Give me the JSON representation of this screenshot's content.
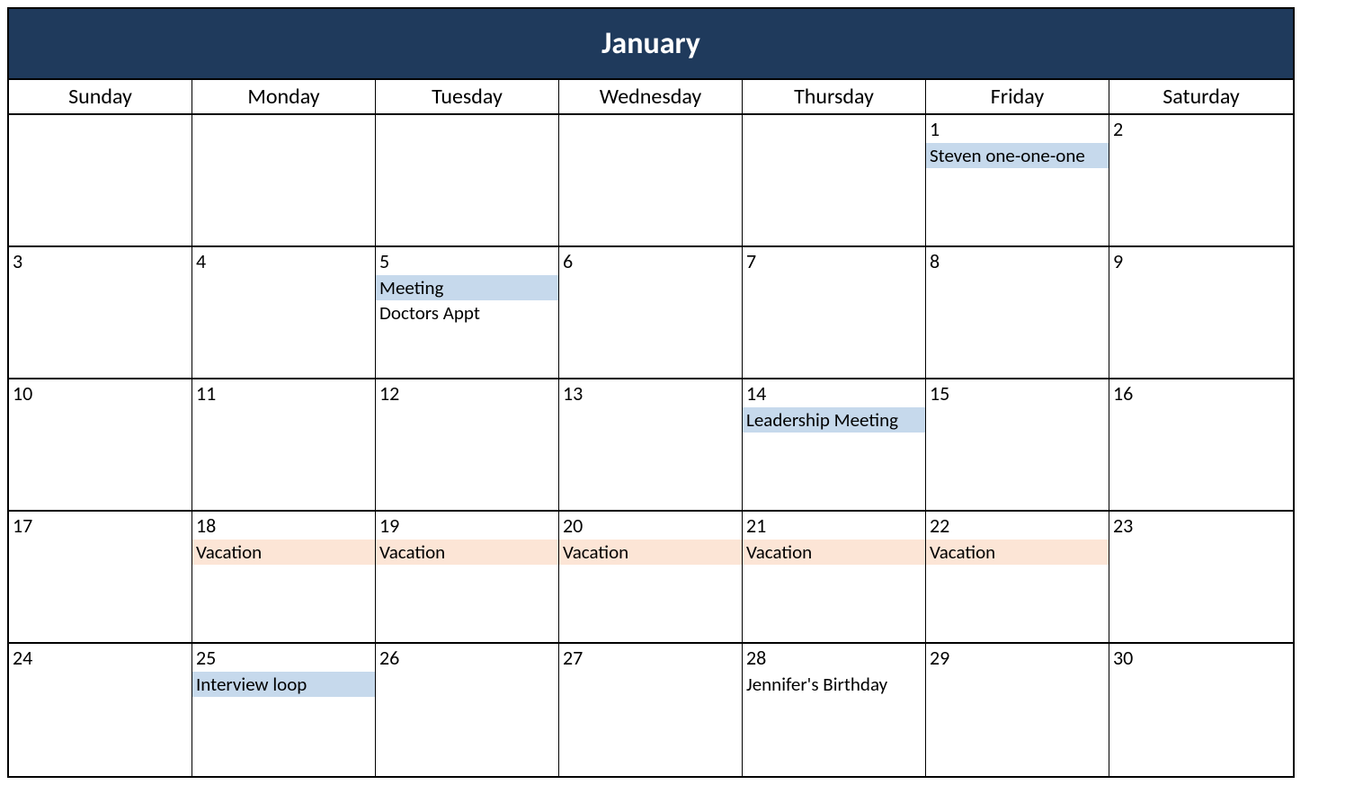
{
  "month": "January",
  "dayHeaders": [
    "Sunday",
    "Monday",
    "Tuesday",
    "Wednesday",
    "Thursday",
    "Friday",
    "Saturday"
  ],
  "colors": {
    "header": "#1f3a5c",
    "eventBlue": "#c6d9ec",
    "eventOrange": "#fce5d6"
  },
  "weeks": [
    [
      {
        "day": "",
        "events": []
      },
      {
        "day": "",
        "events": []
      },
      {
        "day": "",
        "events": []
      },
      {
        "day": "",
        "events": []
      },
      {
        "day": "",
        "events": []
      },
      {
        "day": "1",
        "events": [
          {
            "label": "Steven one-one-one",
            "color": "blue"
          }
        ]
      },
      {
        "day": "2",
        "events": []
      }
    ],
    [
      {
        "day": "3",
        "events": []
      },
      {
        "day": "4",
        "events": []
      },
      {
        "day": "5",
        "events": [
          {
            "label": "Meeting",
            "color": "blue"
          },
          {
            "label": "Doctors Appt",
            "color": "plain"
          }
        ]
      },
      {
        "day": "6",
        "events": []
      },
      {
        "day": "7",
        "events": []
      },
      {
        "day": "8",
        "events": []
      },
      {
        "day": "9",
        "events": []
      }
    ],
    [
      {
        "day": "10",
        "events": []
      },
      {
        "day": "11",
        "events": []
      },
      {
        "day": "12",
        "events": []
      },
      {
        "day": "13",
        "events": []
      },
      {
        "day": "14",
        "events": [
          {
            "label": "Leadership Meeting",
            "color": "blue"
          }
        ]
      },
      {
        "day": "15",
        "events": []
      },
      {
        "day": "16",
        "events": []
      }
    ],
    [
      {
        "day": "17",
        "events": []
      },
      {
        "day": "18",
        "events": [
          {
            "label": "Vacation",
            "color": "orange"
          }
        ]
      },
      {
        "day": "19",
        "events": [
          {
            "label": "Vacation",
            "color": "orange"
          }
        ]
      },
      {
        "day": "20",
        "events": [
          {
            "label": "Vacation",
            "color": "orange"
          }
        ]
      },
      {
        "day": "21",
        "events": [
          {
            "label": "Vacation",
            "color": "orange"
          }
        ]
      },
      {
        "day": "22",
        "events": [
          {
            "label": "Vacation",
            "color": "orange"
          }
        ]
      },
      {
        "day": "23",
        "events": []
      }
    ],
    [
      {
        "day": "24",
        "events": []
      },
      {
        "day": "25",
        "events": [
          {
            "label": "Interview loop",
            "color": "blue"
          }
        ]
      },
      {
        "day": "26",
        "events": []
      },
      {
        "day": "27",
        "events": []
      },
      {
        "day": "28",
        "events": [
          {
            "label": "Jennifer's Birthday",
            "color": "plain"
          }
        ]
      },
      {
        "day": "29",
        "events": []
      },
      {
        "day": "30",
        "events": []
      }
    ]
  ]
}
